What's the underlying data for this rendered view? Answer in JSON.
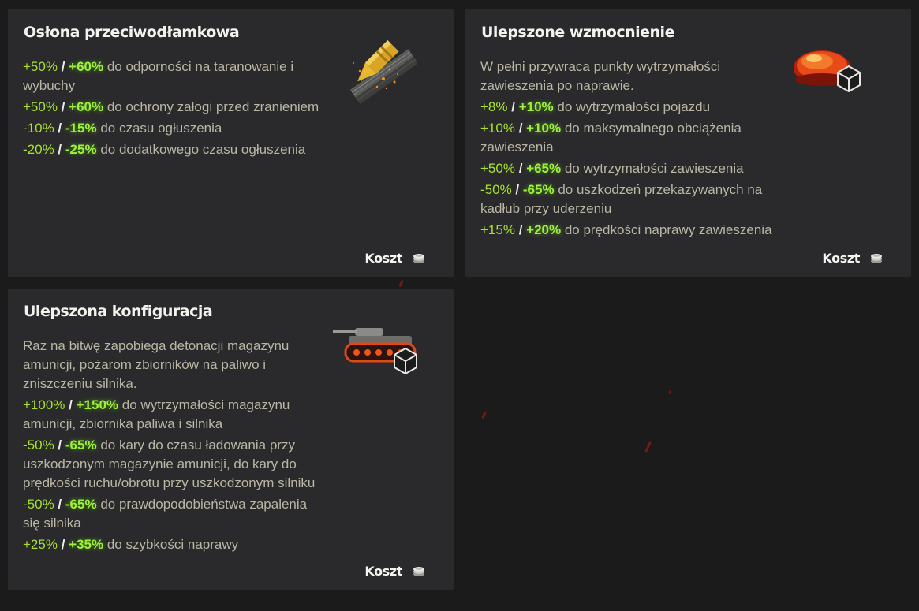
{
  "cards": [
    {
      "title": "Osłona przeciwodłamkowa",
      "lines": [
        {
          "v1": "+50%",
          "sep": "/",
          "v2": "+60%",
          "text": "do odporności na taranowanie i wybuchy"
        },
        {
          "v1": "+50%",
          "sep": "/",
          "v2": "+60%",
          "text": "do ochrony załogi przed zranieniem"
        },
        {
          "v1": "-10%",
          "sep": "/",
          "v2": "-15%",
          "text": "do czasu ogłuszenia"
        },
        {
          "v1": "-20%",
          "sep": "/",
          "v2": "-25%",
          "text": "do dodatkowego czasu ogłuszenia"
        }
      ],
      "cost_label": "Koszt",
      "icon": "spall-liner-shell-icon"
    },
    {
      "title": "Ulepszone wzmocnienie",
      "description": "W pełni przywraca punkty wytrzymałości zawieszenia po naprawie.",
      "lines": [
        {
          "v1": "+8%",
          "sep": "/",
          "v2": "+10%",
          "text": "do wytrzymałości pojazdu"
        },
        {
          "v1": "+10%",
          "sep": "/",
          "v2": "+10%",
          "text": "do maksymalnego obciążenia zawieszenia"
        },
        {
          "v1": "+50%",
          "sep": "/",
          "v2": "+65%",
          "text": "do wytrzymałości zawieszenia"
        },
        {
          "v1": "-50%",
          "sep": "/",
          "v2": "-65%",
          "text": "do uszkodzeń przekazywanych na kadłub przy uderzeniu"
        },
        {
          "v1": "+15%",
          "sep": "/",
          "v2": "+20%",
          "text": "do prędkości naprawy zawieszenia"
        }
      ],
      "cost_label": "Koszt",
      "icon": "improved-suspension-icon"
    },
    {
      "title": "Ulepszona konfiguracja",
      "description": "Raz na bitwę zapobiega detonacji magazynu amunicji, pożarom zbiorników na paliwo i zniszczeniu silnika.",
      "lines": [
        {
          "v1": "+100%",
          "sep": "/",
          "v2": "+150%",
          "text": "do wytrzymałości magazynu amunicji, zbiornika paliwa i silnika"
        },
        {
          "v1": "-50%",
          "sep": "/",
          "v2": "-65%",
          "text": "do kary do czasu ładowania przy uszkodzonym magazynie amunicji, do kary do prędkości ruchu/obrotu przy uszkodzonym silniku"
        },
        {
          "v1": "-50%",
          "sep": "/",
          "v2": "-65%",
          "text": "do prawdopodobieństwa zapalenia się silnika"
        },
        {
          "v1": "+25%",
          "sep": "/",
          "v2": "+35%",
          "text": "do szybkości naprawy"
        }
      ],
      "cost_label": "Koszt",
      "icon": "improved-configuration-tank-icon"
    }
  ],
  "colors": {
    "background": "#1b1b1c",
    "card": "#2a2a2c",
    "accent_green": "#9cf23a",
    "text": "#b9b6a3"
  }
}
